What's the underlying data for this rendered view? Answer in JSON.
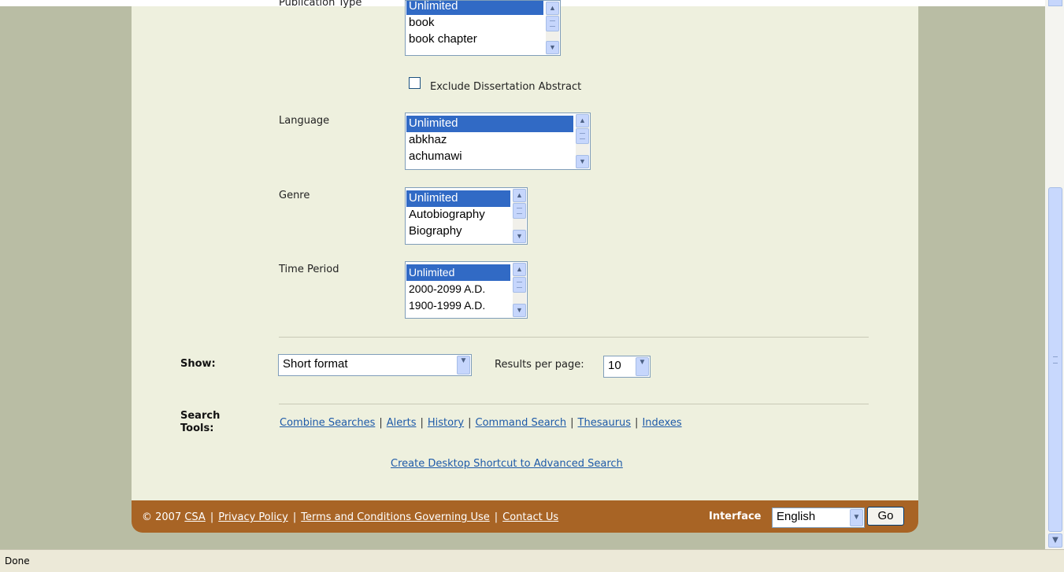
{
  "filters": {
    "publication_type": {
      "label": "Publication Type",
      "options": [
        "Unlimited",
        "book",
        "book chapter"
      ]
    },
    "exclude_dissertation": {
      "label": "Exclude Dissertation Abstract",
      "checked": false
    },
    "language": {
      "label": "Language",
      "options": [
        "Unlimited",
        "abkhaz",
        "achumawi"
      ]
    },
    "genre": {
      "label": "Genre",
      "options": [
        "Unlimited",
        "Autobiography",
        "Biography"
      ]
    },
    "time_period": {
      "label": "Time Period",
      "options": [
        "Unlimited",
        "2000-2099 A.D.",
        "1900-1999 A.D."
      ]
    }
  },
  "show": {
    "label": "Show:",
    "format_value": "Short format",
    "results_label": "Results per page:",
    "results_value": "10"
  },
  "search_tools": {
    "label_line1": "Search",
    "label_line2": "Tools:",
    "links": [
      "Combine Searches",
      "Alerts",
      "History",
      "Command Search",
      "Thesaurus",
      "Indexes"
    ],
    "shortcut_link": "Create Desktop Shortcut to Advanced Search"
  },
  "footer": {
    "copyright": "© 2007",
    "csa_link": "CSA",
    "privacy_link": "Privacy Policy",
    "terms_link": "Terms and Conditions Governing Use",
    "contact_link": "Contact Us",
    "interface_label": "Interface",
    "interface_value": "English",
    "go_label": "Go"
  },
  "status": {
    "text": "Done"
  }
}
